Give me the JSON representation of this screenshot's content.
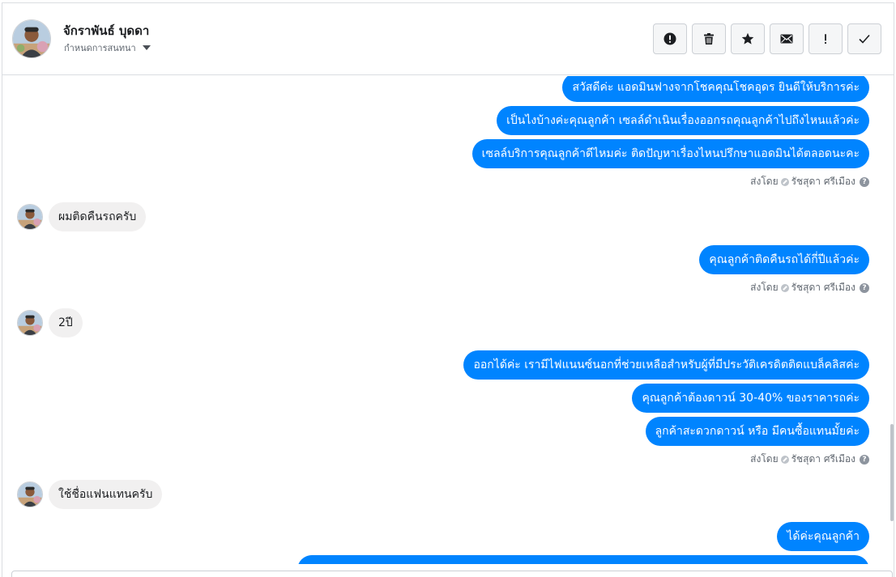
{
  "header": {
    "contact_name": "จักราพันธ์ บุดดา",
    "assign_label": "กำหนดการสนทนา",
    "actions": [
      {
        "icon": "alert-circle-icon",
        "name": "mark-spam-button"
      },
      {
        "icon": "trash-icon",
        "name": "delete-button"
      },
      {
        "icon": "star-icon",
        "name": "star-button"
      },
      {
        "icon": "envelope-icon",
        "name": "mark-unread-button"
      },
      {
        "icon": "exclamation-icon",
        "name": "follow-up-button"
      },
      {
        "icon": "check-icon",
        "name": "mark-done-button"
      }
    ]
  },
  "messages": {
    "g1": [
      "สวัสดีค่ะ แอดมินฟางจากโชคคุณโชคอุดร ยินดีให้บริการค่ะ",
      "เป็นไงบ้างค่ะคุณลูกค้า  เซลล์ดำเนินเรื่องออกรถคุณลูกค้าไปถึงไหนแล้วค่ะ",
      "เซลล์บริการคุณลูกค้าดีไหมค่ะ  ติดปัญหาเรื่องไหนปรึกษาแอดมินได้ตลอดนะคะ"
    ],
    "in1": "ผมติดคืนรถครับ",
    "g2": [
      "คุณลูกค้าติดคืนรถได้กี่ปีแล้วค่ะ"
    ],
    "in2": "2ปี",
    "g3": [
      "ออกได้ค่ะ เรามีไฟแนนซ์นอกที่ช่วยเหลือสำหรับผู้ที่มีประวัติเครดิตติดแบล็คลิสค่ะ",
      "คุณลูกค้าต้องดาวน์ 30-40% ของราคารถค่ะ",
      "ลูกค้าสะดวกดาวน์ หรือ มีคนซื้อแทนมั้ยค่ะ"
    ],
    "in3": "ใช้ชื่อแฟนแทนครับ",
    "g4": [
      "ได้ค่ะคุณลูกค้า"
    ]
  },
  "sent_by": {
    "prefix": "ส่งโดย",
    "agent": "รัชสุดา ศรีเมือง"
  },
  "colors": {
    "outgoing_bubble": "#0084ff",
    "incoming_bubble": "#f1f0f0"
  }
}
